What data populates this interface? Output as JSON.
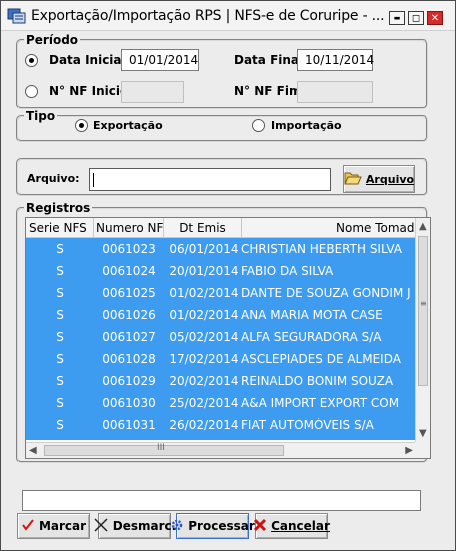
{
  "window": {
    "title": "Exportação/Importação RPS  |  NFS-e de Coruripe - ...",
    "minimize_glyph": "▬",
    "maximize_glyph": "◻",
    "close_glyph": "✕"
  },
  "periodo": {
    "legend": "Período",
    "data_inicial_label": "Data Inicial:",
    "data_inicial_value": "01/01/2014",
    "data_final_label": "Data Final:",
    "data_final_value": "10/11/2014",
    "nf_inicio_label": "N° NF Inicio:",
    "nf_inicio_value": "",
    "nf_fim_label": "N° NF Fim:",
    "nf_fim_value": "",
    "selected": "data"
  },
  "tipo": {
    "legend": "Tipo",
    "exportacao_label": "Exportação",
    "importacao_label": "Importação",
    "selected": "exportacao"
  },
  "arquivo": {
    "label": "Arquivo:",
    "value": "",
    "button_label": "Arquivo",
    "button_icon": "folder-open-icon"
  },
  "registros": {
    "legend": "Registros",
    "columns": [
      "Serie NFS",
      "Numero NF",
      "Dt Emis",
      "Nome Tomador"
    ],
    "rows": [
      [
        "S",
        "0061023",
        "06/01/2014",
        "CHRISTIAN HEBERTH SILVA"
      ],
      [
        "S",
        "0061024",
        "20/01/2014",
        "FABIO DA SILVA"
      ],
      [
        "S",
        "0061025",
        "01/02/2014",
        "DANTE DE SOUZA GONDIM J"
      ],
      [
        "S",
        "0061026",
        "01/02/2014",
        "ANA MARIA MOTA CASE"
      ],
      [
        "S",
        "0061027",
        "05/02/2014",
        "ALFA SEGURADORA S/A"
      ],
      [
        "S",
        "0061028",
        "17/02/2014",
        "ASCLEPIADES DE ALMEIDA"
      ],
      [
        "S",
        "0061029",
        "20/02/2014",
        "REINALDO BONIM SOUZA"
      ],
      [
        "S",
        "0061030",
        "25/02/2014",
        "A&A IMPORT EXPORT COM"
      ],
      [
        "S",
        "0061031",
        "26/02/2014",
        "FIAT AUTOMÓVEIS S/A"
      ]
    ],
    "selection_color": "#3d9cf0"
  },
  "status": {
    "text": ""
  },
  "buttons": {
    "marcar": "Marcar",
    "desmarcar": "Desmarc.",
    "processar": "Processar",
    "cancelar": "Cancelar"
  },
  "colors": {
    "close_button": "#d62b2b",
    "cancel_icon": "#cc1111",
    "processar_icon": "#2a56c8"
  }
}
